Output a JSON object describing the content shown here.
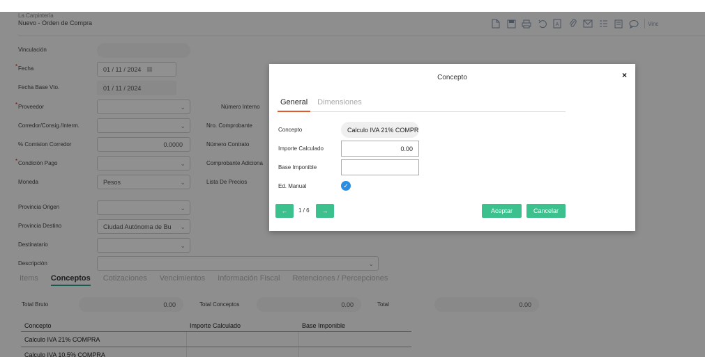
{
  "header": {
    "company": "La Carpintería",
    "title": "Nuevo - Orden de Compra",
    "link": "Vinc"
  },
  "form": {
    "vinculacion": {
      "label": "Vinculación",
      "value": ""
    },
    "fecha": {
      "label": "Fecha",
      "value": "01 / 11 / 2024"
    },
    "fecha_base": {
      "label": "Fecha Base Vto.",
      "value": "01 / 11 / 2024"
    },
    "proveedor": {
      "label": "Proveedor",
      "value": ""
    },
    "corredor": {
      "label": "Corredor/Consig./Interm.",
      "value": ""
    },
    "comision": {
      "label": "% Comision Corredor",
      "value": "0.0000"
    },
    "condicion": {
      "label": "Condición Pago",
      "value": ""
    },
    "moneda": {
      "label": "Moneda",
      "value": "Pesos"
    },
    "provincia_origen": {
      "label": "Provincia Origen",
      "value": ""
    },
    "provincia_destino": {
      "label": "Provincia Destino",
      "value": "Ciudad Autónoma de Bu"
    },
    "destinatario": {
      "label": "Destinatario",
      "value": ""
    },
    "descripcion": {
      "label": "Descripción",
      "value": ""
    },
    "numero_interno": {
      "label": "Número Interno"
    },
    "nro_comprobante": {
      "label": "Nro. Comprobante"
    },
    "numero_contrato": {
      "label": "Número Contrato"
    },
    "comprobante_adicional": {
      "label": "Comprobante Adiciona"
    },
    "lista_precios": {
      "label": "Lista De Precios"
    }
  },
  "main_tabs": [
    "Items",
    "Conceptos",
    "Cotizaciones",
    "Vencimientos",
    "Información Fiscal",
    "Retenciones / Percepciones"
  ],
  "totals": {
    "bruto_label": "Total Bruto",
    "bruto_value": "0.00",
    "conceptos_label": "Total Conceptos",
    "conceptos_value": "0.00",
    "total_label": "Total",
    "total_value": "0.00"
  },
  "table": {
    "headers": [
      "Concepto",
      "Importe Calculado",
      "Base Imponible"
    ],
    "rows": [
      [
        "Calculo IVA 21% COMPRA",
        "",
        ""
      ],
      [
        "Calculo IVA 10.5% COMPRA",
        "",
        ""
      ]
    ]
  },
  "modal": {
    "title": "Concepto",
    "close": "×",
    "tabs": [
      "General",
      "Dimensiones"
    ],
    "concepto_label": "Concepto",
    "concepto_value": "Calculo IVA 21% COMPRA",
    "importe_label": "Importe Calculado",
    "importe_value": "0.00",
    "base_label": "Base Imponible",
    "base_value": "",
    "edmanual_label": "Ed. Manual",
    "pager": "1 / 6",
    "aceptar": "Aceptar",
    "cancelar": "Cancelar"
  },
  "colors": {
    "accent": "#3cc08e",
    "tab_underline": "#e05a2b",
    "check": "#2a8de0"
  }
}
